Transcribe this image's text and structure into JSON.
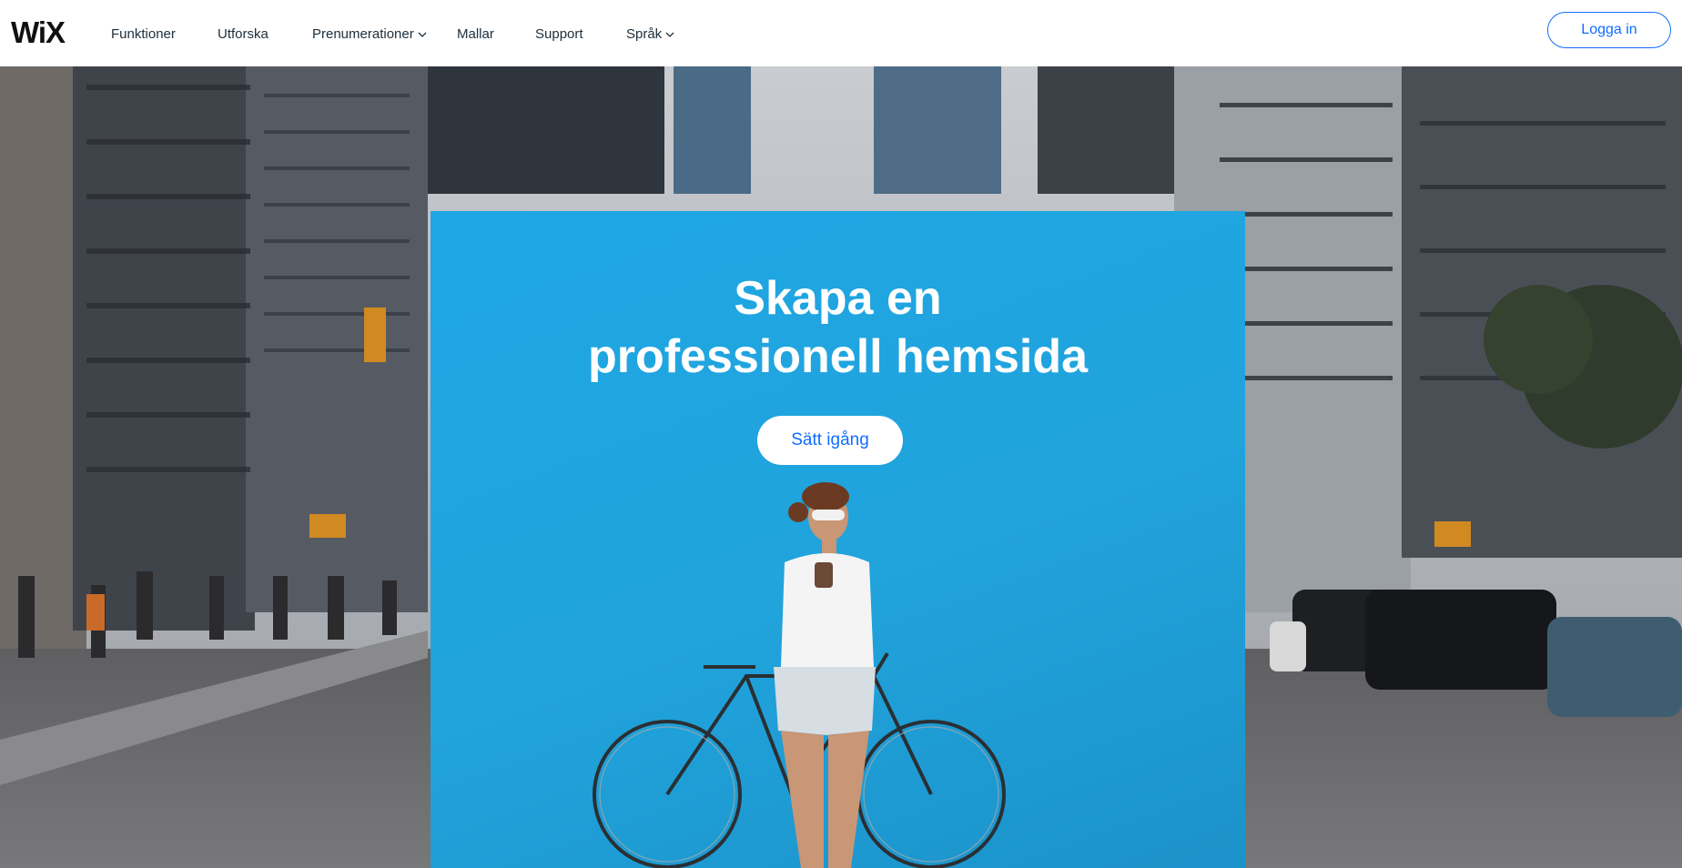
{
  "header": {
    "logo": "WiX",
    "nav": [
      {
        "label": "Funktioner"
      },
      {
        "label": "Utforska"
      },
      {
        "label": "Prenumerationer",
        "dropdown": true
      },
      {
        "label": "Mallar"
      },
      {
        "label": "Support"
      },
      {
        "label": "Språk",
        "dropdown": true
      }
    ],
    "login_label": "Logga in"
  },
  "hero": {
    "headline_line1": "Skapa en",
    "headline_line2": "professionell hemsida",
    "cta_label": "Sätt igång"
  },
  "colors": {
    "brand_blue": "#116dff",
    "panel_blue": "#21a3dc"
  }
}
